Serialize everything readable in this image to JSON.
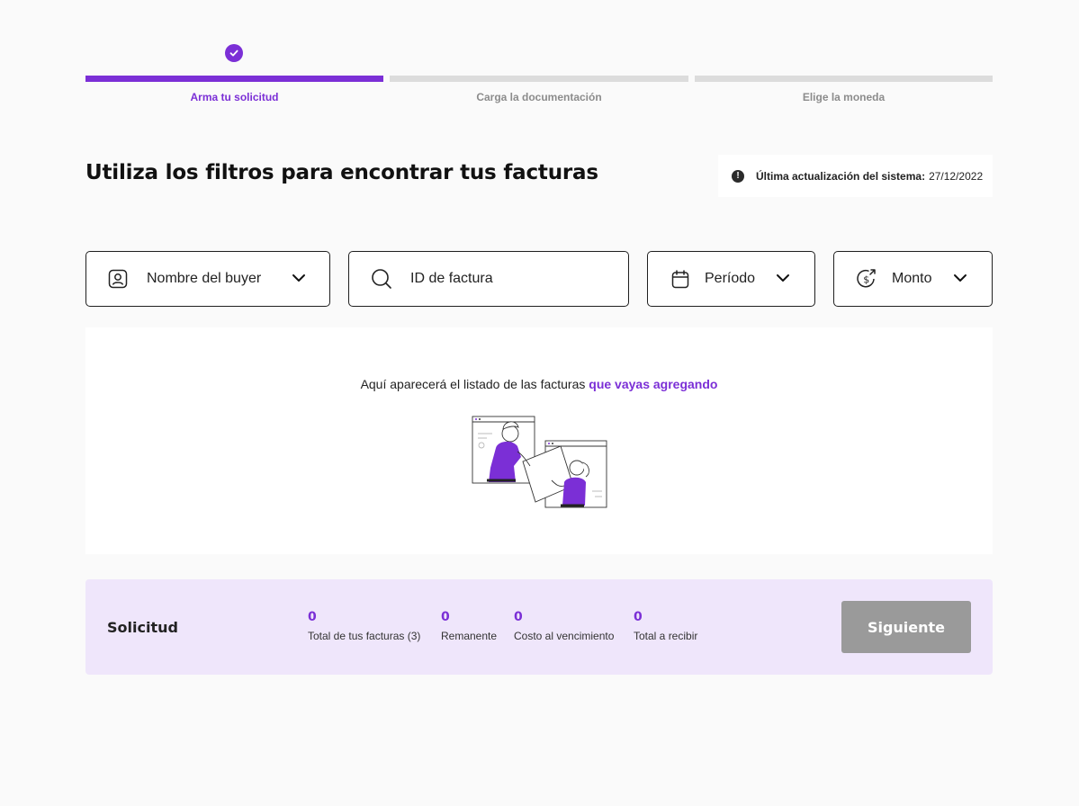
{
  "stepper": {
    "steps": [
      {
        "label": "Arma tu solicitud",
        "state": "completed"
      },
      {
        "label": "Carga la documentación",
        "state": "pending"
      },
      {
        "label": "Elige la moneda",
        "state": "pending"
      }
    ]
  },
  "header": {
    "title": "Utiliza los filtros para encontrar tus facturas",
    "update_label": "Última actualización del sistema:",
    "update_date": "27/12/2022"
  },
  "filters": {
    "buyer": {
      "label": "Nombre del buyer",
      "icon": "user-badge-icon"
    },
    "invoice_id": {
      "placeholder": "ID de factura",
      "icon": "search-icon"
    },
    "period": {
      "label": "Período",
      "icon": "calendar-icon"
    },
    "amount": {
      "label": "Monto",
      "icon": "dollar-exchange-icon"
    }
  },
  "empty_state": {
    "text": "Aquí aparecerá el listado de las facturas",
    "highlight": "que vayas agregando"
  },
  "summary": {
    "title": "Solicitud",
    "metrics": [
      {
        "value": "0",
        "label": "Total de tus facturas (3)"
      },
      {
        "value": "0",
        "label": "Remanente"
      },
      {
        "value": "0",
        "label": "Costo al vencimiento"
      },
      {
        "value": "0",
        "label": "Total a recibir"
      }
    ],
    "next_label": "Siguiente"
  },
  "colors": {
    "accent": "#7b2fd6",
    "summary_bg": "#efe6fb",
    "disabled_button": "#9a9a9a"
  }
}
